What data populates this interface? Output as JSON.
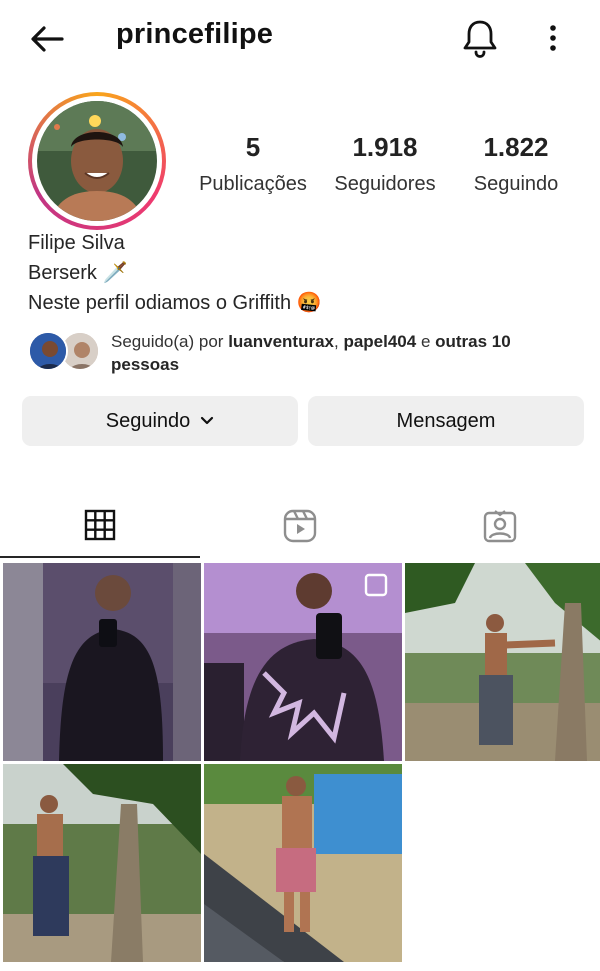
{
  "header": {
    "username": "princefilipe"
  },
  "stats": [
    {
      "value": "5",
      "label": "Publicações"
    },
    {
      "value": "1.918",
      "label": "Seguidores"
    },
    {
      "value": "1.822",
      "label": "Seguindo"
    }
  ],
  "profile": {
    "name": "Filipe Silva",
    "bio_line1": "Berserk 🗡️",
    "bio_line2": "Neste perfil odiamos o Griffith 🤬"
  },
  "followed_by": {
    "prefix": "Seguido(a) por ",
    "user1": "luanventurax",
    "separator": ", ",
    "user2": "papel404",
    "conjunction": " e ",
    "others": "outras 10 pessoas"
  },
  "buttons": {
    "following_label": "Seguindo",
    "message_label": "Mensagem"
  },
  "tabs": [
    {
      "name": "grid-tab",
      "icon": "grid-icon",
      "active": true
    },
    {
      "name": "reels-tab",
      "icon": "reels-icon",
      "active": false
    },
    {
      "name": "tagged-tab",
      "icon": "tagged-icon",
      "active": false
    }
  ],
  "posts": [
    {
      "icon": "photo",
      "multi": false
    },
    {
      "icon": "photo",
      "multi": true
    },
    {
      "icon": "photo",
      "multi": false
    },
    {
      "icon": "photo",
      "multi": false
    },
    {
      "icon": "photo",
      "multi": false
    }
  ],
  "colors": {
    "ring_start": "#f9a51b",
    "ring_mid": "#ef3a6e",
    "ring_end": "#c13584",
    "button_bg": "#efefef",
    "text": "#262626"
  }
}
